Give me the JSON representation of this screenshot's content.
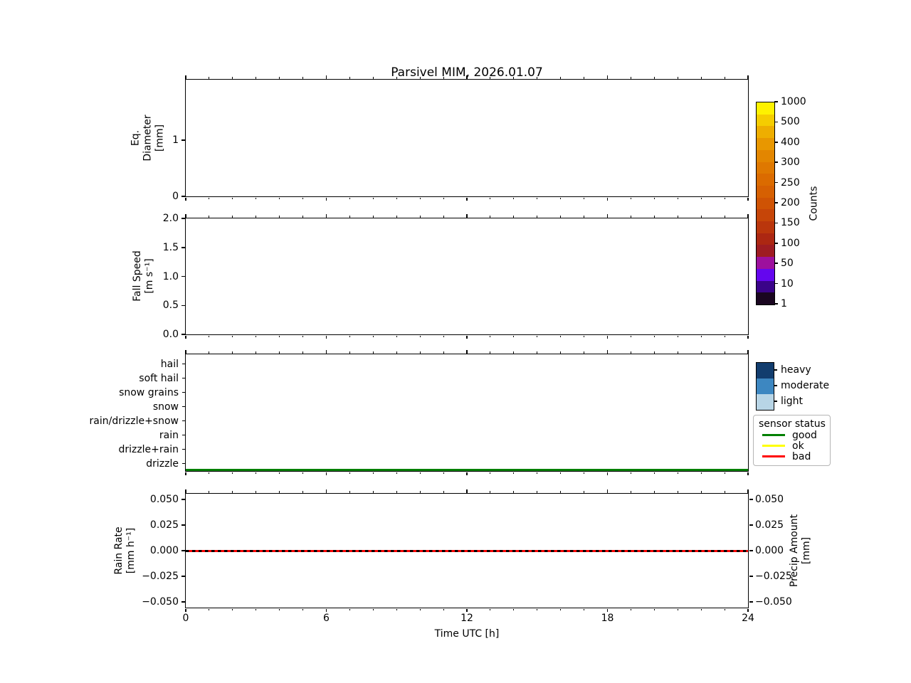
{
  "title": "Parsivel MIM, 2026.01.07",
  "chart_data": {
    "type": "line",
    "title": "Parsivel MIM, 2026.01.07",
    "xlabel": "Time UTC [h]",
    "x_axis": {
      "range": [
        0,
        24
      ],
      "major_ticks": [
        0,
        6,
        12,
        18,
        24
      ],
      "tick_labels": [
        "0",
        "6",
        "12",
        "18",
        "24"
      ],
      "minor_step_hours": 1
    },
    "panels": [
      {
        "id": "eq-diameter",
        "ylabel": "Eq.\nDiameter\n[mm]",
        "ylim": [
          0,
          2.07
        ],
        "yticks": [
          {
            "value": 0,
            "label": "0"
          },
          {
            "value": 1,
            "label": "1"
          }
        ],
        "series": []
      },
      {
        "id": "fall-speed",
        "ylabel": "Fall Speed\n[m s⁻¹]",
        "ylim": [
          0,
          2.0
        ],
        "yticks": [
          {
            "value": 0.0,
            "label": "0.0"
          },
          {
            "value": 0.5,
            "label": "0.5"
          },
          {
            "value": 1.0,
            "label": "1.0"
          },
          {
            "value": 1.5,
            "label": "1.5"
          },
          {
            "value": 2.0,
            "label": "2.0"
          }
        ],
        "series": []
      },
      {
        "id": "precip-type",
        "categories": [
          "hail",
          "soft hail",
          "snow grains",
          "snow",
          "rain/drizzle+snow",
          "rain",
          "drizzle+rain",
          "drizzle"
        ],
        "series": [
          {
            "name": "sensor status",
            "value": "good",
            "color": "#008000",
            "x": [
              0,
              24
            ],
            "y": "constant, below drizzle (no precipitation)"
          }
        ]
      },
      {
        "id": "rain-rate",
        "ylabel": "Rain Rate\n[mm h⁻¹]",
        "ylabel_right": "Precip Amount\n[mm]",
        "ylim": [
          -0.0555,
          0.0555
        ],
        "yticks": [
          {
            "value": 0.05,
            "label": "0.050"
          },
          {
            "value": 0.025,
            "label": "0.025"
          },
          {
            "value": 0.0,
            "label": "0.000"
          },
          {
            "value": -0.025,
            "label": "−0.025"
          },
          {
            "value": -0.05,
            "label": "−0.050"
          }
        ],
        "yticks_right": [
          {
            "value": 0.05,
            "label": "0.050"
          },
          {
            "value": 0.025,
            "label": "0.025"
          },
          {
            "value": 0.0,
            "label": "0.000"
          },
          {
            "value": -0.025,
            "label": "−0.025"
          },
          {
            "value": -0.05,
            "label": "−0.050"
          }
        ],
        "series": [
          {
            "name": "Rain Rate",
            "color": "#ff0000",
            "style": "solid",
            "x": [
              0,
              24
            ],
            "y": [
              0.0,
              0.0
            ]
          },
          {
            "name": "Precip Amount",
            "color": "#000000",
            "style": "dashed",
            "x": [
              0,
              24
            ],
            "y": [
              0.0,
              0.0
            ]
          }
        ]
      }
    ],
    "colorbar": {
      "label": "Counts",
      "tick_labels": [
        "1",
        "10",
        "50",
        "100",
        "150",
        "200",
        "250",
        "300",
        "400",
        "500",
        "1000"
      ],
      "colors_bottom_to_top": [
        "#1a0620",
        "#3a0389",
        "#6406ee",
        "#9d109d",
        "#9e1c22",
        "#ac2712",
        "#ba360c",
        "#c64508",
        "#cf5304",
        "#d66002",
        "#db6b00",
        "#df7800",
        "#e38600",
        "#e89700",
        "#eeae00",
        "#f5cd00",
        "#fef200"
      ]
    },
    "intensity_legend": {
      "items": [
        {
          "label": "heavy",
          "color": "#123d6e"
        },
        {
          "label": "moderate",
          "color": "#3d87c1"
        },
        {
          "label": "light",
          "color": "#b8d5e6"
        }
      ]
    },
    "sensor_status_legend": {
      "title": "sensor status",
      "items": [
        {
          "label": "good",
          "color": "#008000"
        },
        {
          "label": "ok",
          "color": "#ffff00"
        },
        {
          "label": "bad",
          "color": "#ff0000"
        }
      ]
    }
  }
}
